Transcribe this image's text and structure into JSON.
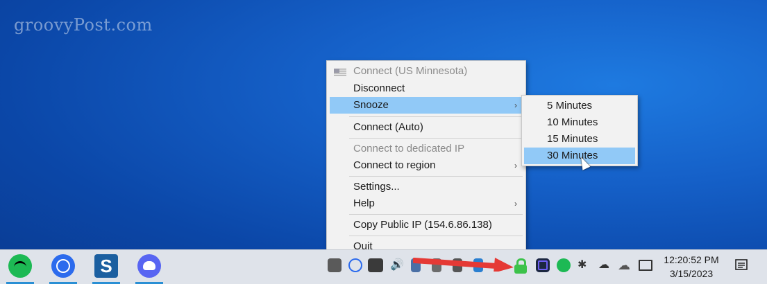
{
  "desktop": {
    "watermark": "groovyPost.com",
    "background_color": "#1560c8"
  },
  "menu": {
    "items": [
      {
        "label": "Connect (US Minnesota)",
        "disabled": true,
        "icon": "us-flag-icon"
      },
      {
        "label": "Disconnect"
      },
      {
        "label": "Snooze",
        "highlighted": true,
        "submenu": true
      },
      {
        "label": "Connect (Auto)"
      },
      {
        "label": "Connect to dedicated IP",
        "disabled": true
      },
      {
        "label": "Connect to region",
        "submenu": true
      },
      {
        "label": "Settings..."
      },
      {
        "label": "Help",
        "submenu": true
      },
      {
        "label": "Copy Public IP (154.6.86.138)"
      },
      {
        "label": "Quit"
      }
    ],
    "arrow_glyph": "›"
  },
  "submenu": {
    "items": [
      {
        "label": "5 Minutes"
      },
      {
        "label": "10 Minutes"
      },
      {
        "label": "15 Minutes"
      },
      {
        "label": "30 Minutes",
        "highlighted": true
      }
    ]
  },
  "taskbar": {
    "apps": [
      "spotify-icon",
      "signal-icon",
      "snagit-icon",
      "discord-icon"
    ],
    "tray_icons": [
      "discord-tray-icon",
      "signal-tray-icon",
      "nvidia-icon",
      "volume-icon",
      "vpn-lock-icon",
      "record-icon",
      "spotify-tray-icon",
      "slack-icon",
      "cloud-upload-icon",
      "onedrive-icon",
      "network-icon"
    ],
    "clock": {
      "time": "12:20:52 PM",
      "date": "3/15/2023"
    },
    "accent_color": "#3cc24a",
    "annotation_arrow_color": "#e53935"
  }
}
